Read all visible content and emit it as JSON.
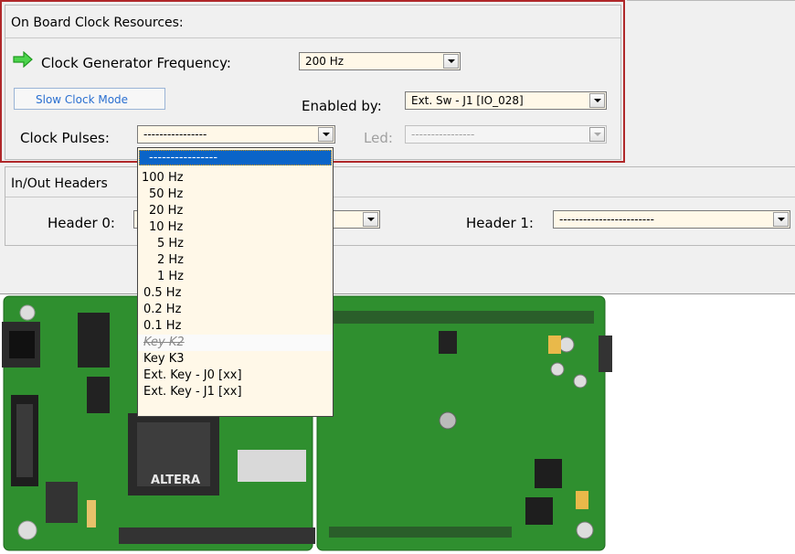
{
  "clock_group": {
    "title": "On Board Clock Resources:",
    "freq_label": "Clock Generator Frequency:",
    "freq_value": "200 Hz",
    "slow_button": "Slow Clock Mode",
    "enabled_label": "Enabled by:",
    "enabled_value": "Ext. Sw - J1 [IO_028]",
    "pulses_label": "Clock Pulses:",
    "pulses_value": "----------------",
    "led_label": "Led:",
    "led_value": "----------------"
  },
  "io_group": {
    "title": "In/Out Headers",
    "header0_label": "Header 0:",
    "header1_label": "Header 1:",
    "header1_value": "------------------------"
  },
  "dropdown": {
    "items": [
      "----------------",
      "100 Hz",
      "50 Hz",
      "20 Hz",
      "10 Hz",
      "5 Hz",
      "2 Hz",
      "1 Hz",
      "0.5 Hz",
      "0.2 Hz",
      "0.1 Hz",
      "Key K2",
      "Key K3",
      "Ext. Key - J0 [xx]",
      "Ext. Key - J1 [xx]"
    ]
  },
  "board": {
    "chip_logo": "ALTERA"
  },
  "colors": {
    "highlight_border": "#b0282a",
    "pcb_green": "#2e8b2e",
    "selection_blue": "#0a64c8",
    "arrow_green": "#3ec43e"
  }
}
